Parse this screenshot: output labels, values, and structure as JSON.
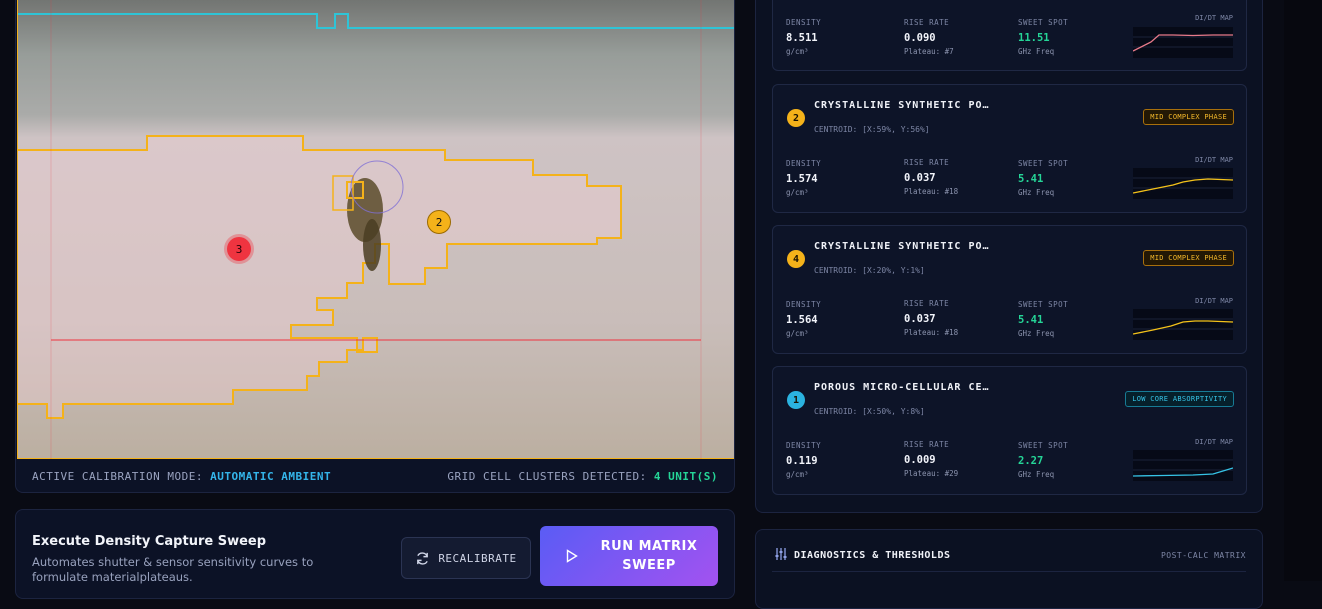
{
  "viewer": {
    "footer_mode_label": "ACTIVE CALIBRATION MODE:",
    "footer_mode_value": "AUTOMATIC AMBIENT",
    "footer_clusters_label": "GRID CELL CLUSTERS DETECTED:",
    "footer_clusters_value": "4 UNIT(S)",
    "markers": [
      {
        "label": "3",
        "color": "red"
      },
      {
        "label": "2",
        "color": "amber"
      }
    ]
  },
  "capture": {
    "title": "Execute Density Capture Sweep",
    "description": "Automates shutter & sensor sensitivity curves to formulate materialplateaus.",
    "recalibrate_label": "RECALIBRATE",
    "run_label": "RUN MATRIX SWEEP"
  },
  "cards": [
    {
      "density_label": "DENSITY",
      "density": "8.511",
      "density_unit": "g/cm³",
      "rise_label": "RISE RATE",
      "rise": "0.090",
      "plateau": "Plateau: #7",
      "sweet_label": "SWEET SPOT",
      "sweet": "11.51",
      "sweet_unit": "GHz Freq",
      "map_label": "DI/DT MAP",
      "spark_color": "#e87a8a"
    },
    {
      "num": "2",
      "num_color": "#f4b21a",
      "title": "CRYSTALLINE SYNTHETIC PO…",
      "centroid": "CENTROID: [X:59%, Y:56%]",
      "phase": "MID COMPLEX PHASE",
      "phase_style": "amber",
      "density_label": "DENSITY",
      "density": "1.574",
      "density_unit": "g/cm³",
      "rise_label": "RISE RATE",
      "rise": "0.037",
      "plateau": "Plateau: #18",
      "sweet_label": "SWEET SPOT",
      "sweet": "5.41",
      "sweet_unit": "GHz Freq",
      "map_label": "DI/DT MAP",
      "spark_color": "#f4c21a"
    },
    {
      "num": "4",
      "num_color": "#f4b21a",
      "title": "CRYSTALLINE SYNTHETIC PO…",
      "centroid": "CENTROID: [X:20%, Y:1%]",
      "phase": "MID COMPLEX PHASE",
      "phase_style": "amber",
      "density_label": "DENSITY",
      "density": "1.564",
      "density_unit": "g/cm³",
      "rise_label": "RISE RATE",
      "rise": "0.037",
      "plateau": "Plateau: #18",
      "sweet_label": "SWEET SPOT",
      "sweet": "5.41",
      "sweet_unit": "GHz Freq",
      "map_label": "DI/DT MAP",
      "spark_color": "#f4c21a"
    },
    {
      "num": "1",
      "num_color": "#2bb3e0",
      "title": "POROUS MICRO-CELLULAR CE…",
      "centroid": "CENTROID: [X:50%, Y:8%]",
      "phase": "LOW CORE ABSORPTIVITY",
      "phase_style": "cyan",
      "density_label": "DENSITY",
      "density": "0.119",
      "density_unit": "g/cm³",
      "rise_label": "RISE RATE",
      "rise": "0.009",
      "plateau": "Plateau: #29",
      "sweet_label": "SWEET SPOT",
      "sweet": "2.27",
      "sweet_unit": "GHz Freq",
      "map_label": "DI/DT MAP",
      "spark_color": "#36c3e6"
    }
  ],
  "diagnostics": {
    "title": "DIAGNOSTICS & THRESHOLDS",
    "right_label": "POST-CALC MATRIX"
  }
}
